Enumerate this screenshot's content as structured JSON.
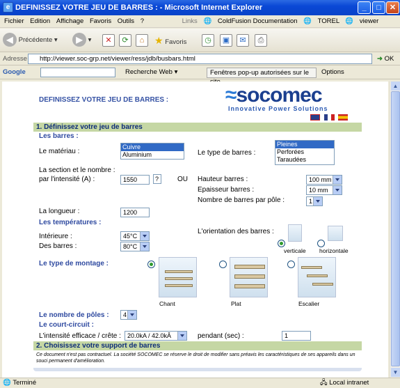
{
  "window": {
    "title": "DEFINISSEZ VOTRE JEU DE BARRES : - Microsoft Internet Explorer"
  },
  "menu": [
    "Fichier",
    "Edition",
    "Affichage",
    "Favoris",
    "Outils",
    "?"
  ],
  "links": {
    "label": "Links",
    "items": [
      "ColdFusion Documentation",
      "TOREL",
      "viewer"
    ]
  },
  "toolbar": {
    "back": "Précédente",
    "favorites": "Favoris"
  },
  "address": {
    "label": "Adresse",
    "url": "http://viewer.soc-grp.net/viewer/ress/jdb/busbars.html",
    "go": "OK"
  },
  "google": {
    "brand": "Google",
    "search": "Recherche Web",
    "popups": "Fenêtres pop-up autorisées sur le site",
    "options": "Options"
  },
  "page": {
    "heading": "DEFINISSEZ VOTRE JEU DE BARRES :",
    "logo": "socomec",
    "tagline": "Innovative Power Solutions",
    "section1": "1. Définissez votre jeu de barres",
    "barres": "Les barres :",
    "materiau_label": "Le matériau :",
    "materiau_options": [
      "Cuivre",
      "Aluminium"
    ],
    "type_label": "Le type de barres :",
    "type_options": [
      "Pleines",
      "Perforées",
      "Taraudées"
    ],
    "section_label1": "La section et le nombre :",
    "section_label2": "par l'intensité (A) :",
    "intensite": "1550",
    "help": "?",
    "ou": "OU",
    "hauteur_label": "Hauteur barres :",
    "hauteur": "100 mm",
    "epaisseur_label": "Epaisseur barres :",
    "epaisseur": "10 mm",
    "nombre_label": "Nombre de barres par pôle :",
    "nombre": "1",
    "longueur_label": "La longueur :",
    "longueur": "1200",
    "temps": "Les températures :",
    "interieure_label": "Intérieure :",
    "interieure": "45°C",
    "desbarres_label": "Des barres :",
    "desbarres": "80°C",
    "orientation_label": "L'orientation des barres :",
    "verticale": "verticale",
    "horizontale": "horizontale",
    "montage_label": "Le type de montage :",
    "chant": "Chant",
    "plat": "Plat",
    "escalier": "Escalier",
    "poles_label": "Le nombre de pôles :",
    "poles": "4",
    "cc": "Le court-circuit :",
    "efficace_label": "L'intensité efficace / crête :",
    "efficace": "20.0kA / 42.0kÂ",
    "pendant_label": "pendant (sec) :",
    "pendant": "1",
    "section2": "2. Choisissez votre support de barres",
    "disclaimer": "Ce document n'est pas contractuel. La société SOCOMEC se réserve le droit de modifier sans préavis les caractéristiques de ses appareils dans un souci permanent d'amélioration."
  },
  "status": {
    "left": "Terminé",
    "right": "Local intranet"
  },
  "colors": {
    "titlebar": "#0a48d6",
    "section": "#c5d7a4",
    "accent": "#2f4aa0",
    "logo": "#1b3f8f"
  }
}
